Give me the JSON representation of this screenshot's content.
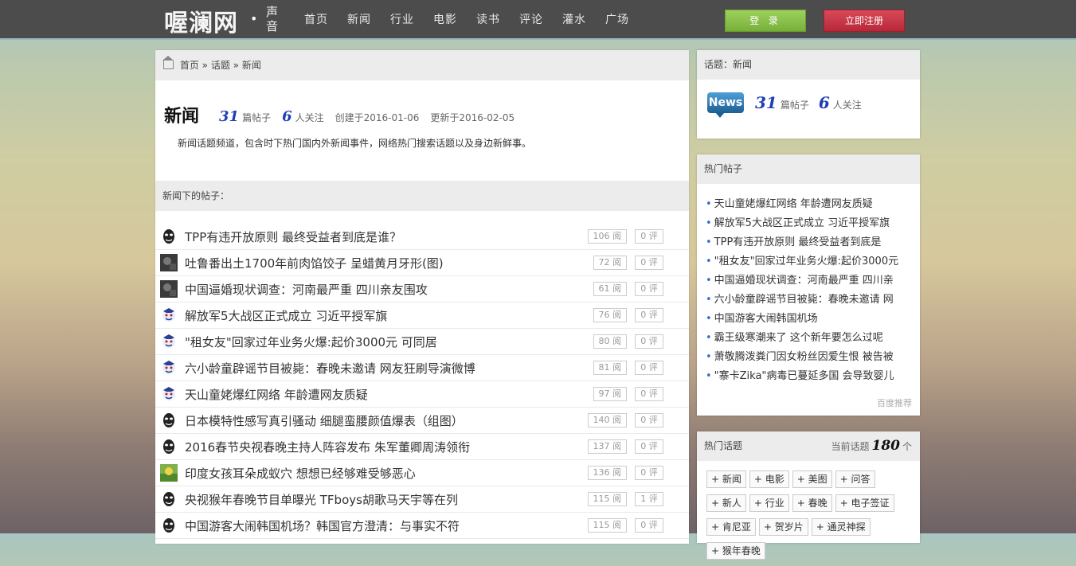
{
  "header": {
    "logo": "喔澜网",
    "logo_sub": "声音",
    "nav": [
      "首页",
      "新闻",
      "行业",
      "电影",
      "读书",
      "评论",
      "灌水",
      "广场"
    ],
    "login": "登 录",
    "register": "立即注册"
  },
  "breadcrumb": {
    "home": "首页",
    "sep1": " » ",
    "topic": "话题",
    "sep2": " » ",
    "current": "新闻"
  },
  "topic": {
    "title": "新闻",
    "posts_count": "31",
    "posts_label": "篇帖子",
    "followers_count": "6",
    "followers_label": "人关注",
    "created": "创建于2016-01-06",
    "updated": "更新于2016-02-05",
    "description": "新闻话题频道，包含时下热门国内外新闻事件，网络热门搜索话题以及身边新鲜事。"
  },
  "posts_header": "新闻下的帖子：",
  "posts": [
    {
      "title": "TPP有违开放原则 最终受益者到底是谁？",
      "reads": "106 阅",
      "comments": "0 评",
      "avatar": "mask"
    },
    {
      "title": "吐鲁番出土1700年前肉馅饺子 呈蜡黄月牙形(图)",
      "reads": "72 阅",
      "comments": "0 评",
      "avatar": "dark"
    },
    {
      "title": "中国逼婚现状调查：河南最严重 四川亲友围攻",
      "reads": "61 阅",
      "comments": "0 评",
      "avatar": "dark"
    },
    {
      "title": "解放军5大战区正式成立 习近平授军旗",
      "reads": "76 阅",
      "comments": "0 评",
      "avatar": "joker"
    },
    {
      "title": "\"租女友\"回家过年业务火爆:起价3000元 可同居",
      "reads": "80 阅",
      "comments": "0 评",
      "avatar": "joker"
    },
    {
      "title": "六小龄童辟谣节目被毙：春晚未邀请 网友狂刷导演微博",
      "reads": "81 阅",
      "comments": "0 评",
      "avatar": "joker"
    },
    {
      "title": "天山童姥爆红网络 年龄遭网友质疑",
      "reads": "97 阅",
      "comments": "0 评",
      "avatar": "joker"
    },
    {
      "title": "日本模特性感写真引骚动 细腿蛮腰颜值爆表（组图）",
      "reads": "140 阅",
      "comments": "0 评",
      "avatar": "mask"
    },
    {
      "title": "2016春节央视春晚主持人阵容发布 朱军董卿周涛领衔",
      "reads": "137 阅",
      "comments": "0 评",
      "avatar": "mask"
    },
    {
      "title": "印度女孩耳朵成蚁穴 想想已经够难受够恶心",
      "reads": "136 阅",
      "comments": "0 评",
      "avatar": "flower"
    },
    {
      "title": "央视猴年春晚节目单曝光 TFboys胡歌马天宇等在列",
      "reads": "115 阅",
      "comments": "1 评",
      "avatar": "mask"
    },
    {
      "title": "中国游客大闹韩国机场？韩国官方澄清：与事实不符",
      "reads": "115 阅",
      "comments": "0 评",
      "avatar": "mask"
    }
  ],
  "side_topic": {
    "header": "话题：新闻",
    "icon_text": "News",
    "posts_count": "31",
    "posts_label": "篇帖子",
    "followers_count": "6",
    "followers_label": "人关注"
  },
  "hot_posts": {
    "header": "热门帖子",
    "items": [
      "天山童姥爆红网络 年龄遭网友质疑",
      "解放军5大战区正式成立 习近平授军旗",
      "TPP有违开放原则 最终受益者到底是",
      "\"租女友\"回家过年业务火爆:起价3000元",
      "中国逼婚现状调查：河南最严重 四川亲",
      "六小龄童辟谣节目被毙：春晚未邀请 网",
      "中国游客大闹韩国机场",
      "霸王级寒潮来了 这个新年要怎么过呢",
      "萧敬腾泼粪门因女粉丝因爱生恨 被告被",
      "\"寨卡Zika\"病毒已蔓延多国 会导致婴儿"
    ],
    "footer": "百度推荐"
  },
  "hot_topics": {
    "header": "热门话题",
    "current_label": "当前话题",
    "current_count": "180",
    "current_unit": "个",
    "tags": [
      "+ 新闻",
      "+ 电影",
      "+ 美图",
      "+ 问答",
      "+ 新人",
      "+ 行业",
      "+ 春晚",
      "+ 电子签证",
      "+ 肯尼亚",
      "+ 贺岁片",
      "+ 通灵神探",
      "+ 猴年春晚"
    ]
  }
}
